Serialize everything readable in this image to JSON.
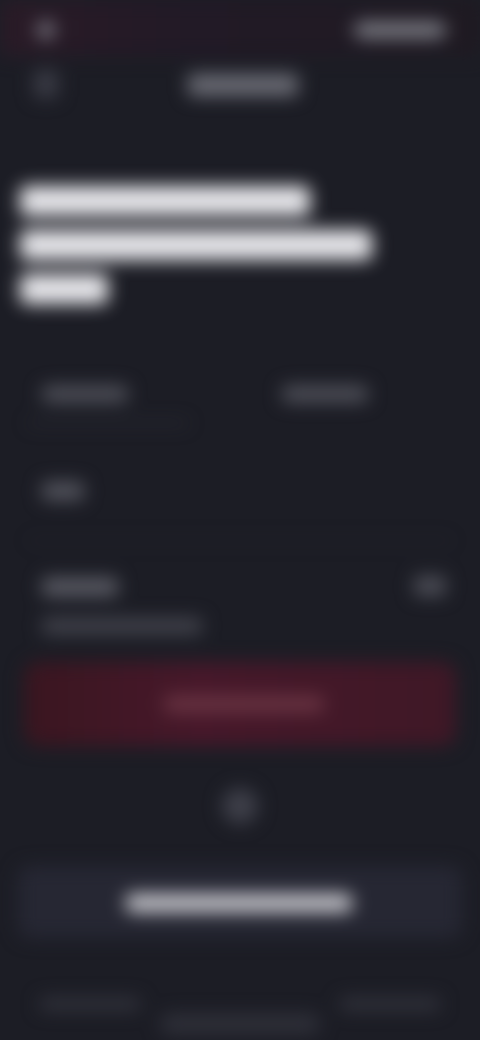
{
  "screen": {
    "state": "blurred"
  },
  "colors": {
    "background": "#1c1d25",
    "primary_button": "#47182a",
    "secondary_button": "#262733",
    "headline": "#e8e8ec"
  },
  "icons": {
    "status": "status-dot-icon",
    "back": "back-arrow-icon",
    "or": "circle-icon"
  }
}
